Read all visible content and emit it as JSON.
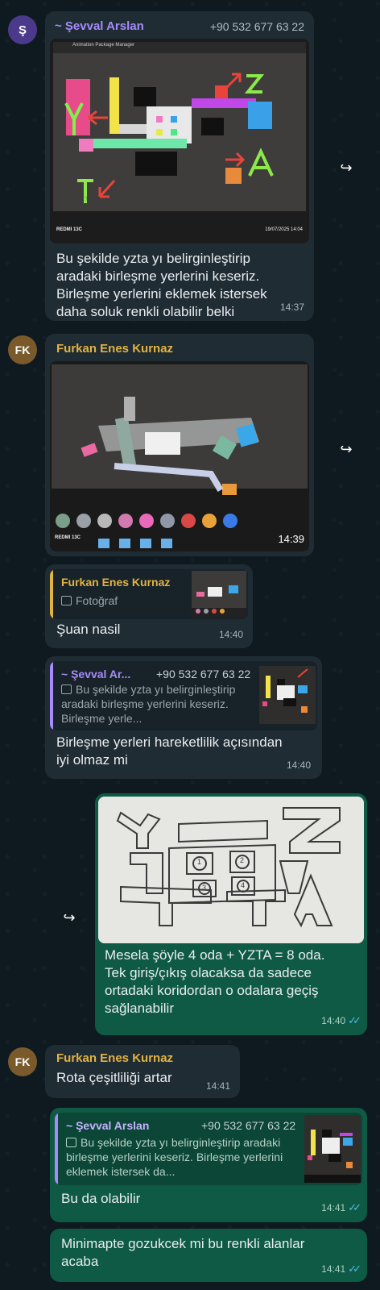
{
  "messages": {
    "m1": {
      "avatar": "Ş",
      "sender": "~ Şevval Arslan",
      "phone": "+90 532 677 63 22",
      "image_caption_left": "REDMI 13C",
      "image_caption_right": "19/07/2025 14:04",
      "image_ui_text": "Animation   Package Manager",
      "image_letters": "Y ← U T ↗ Z T ↙ A → A",
      "text": "Bu şekilde yzta yı belirginleştirip aradaki birleşme yerlerini keseriz. Birleşme yerlerini eklemek istersek daha soluk renkli olabilir belki",
      "time": "14:37"
    },
    "m2": {
      "avatar": "FK",
      "sender": "Furkan Enes Kurnaz",
      "image_caption": "REDMI 13C",
      "time": "14:39"
    },
    "m3": {
      "reply_name": "Furkan Enes Kurnaz",
      "reply_text": "Fotoğraf",
      "text": "Şuan nasil",
      "time": "14:40"
    },
    "m4": {
      "reply_name": "~ Şevval Ar...",
      "reply_phone": "+90 532 677 63 22",
      "reply_text": "Bu şekilde yzta yı belirginleştirip aradaki birleşme yerlerini keseriz. Birleşme yerle...",
      "text": "Birleşme yerleri hareketlilik açısından iyi olmaz mi",
      "time": "14:40"
    },
    "m5": {
      "sketch_numbers": [
        "1",
        "2",
        "3",
        "4"
      ],
      "sketch_letters": "YZTA",
      "text": "Mesela şöyle 4 oda + YZTA = 8 oda. Tek giriş/çıkış olacaksa da sadece ortadaki koridordan o odalara geçiş sağlanabilir",
      "time": "14:40"
    },
    "m6": {
      "avatar": "FK",
      "sender": "Furkan Enes Kurnaz",
      "text": "Rota çeşitliliği artar",
      "time": "14:41"
    },
    "m7": {
      "reply_name": "~ Şevval Arslan",
      "reply_phone": "+90 532 677 63 22",
      "reply_text": "Bu şekilde yzta yı belirginleştirip aradaki birleşme yerlerini keseriz. Birleşme yerlerini eklemek istersek da...",
      "text": "Bu da olabilir",
      "time": "14:41"
    },
    "m8": {
      "text": "Minimapte gozukcek mi bu renkli alanlar acaba",
      "time": "14:41"
    }
  },
  "icons": {
    "forward": "forward-icon",
    "read": "double-check-icon",
    "photo": "photo-icon"
  },
  "colors": {
    "incoming": "#1f2c34",
    "outgoing": "#0e5a45",
    "sevval": "#a78bfa",
    "furkan": "#e3b341",
    "read_tick": "#53bdeb"
  }
}
